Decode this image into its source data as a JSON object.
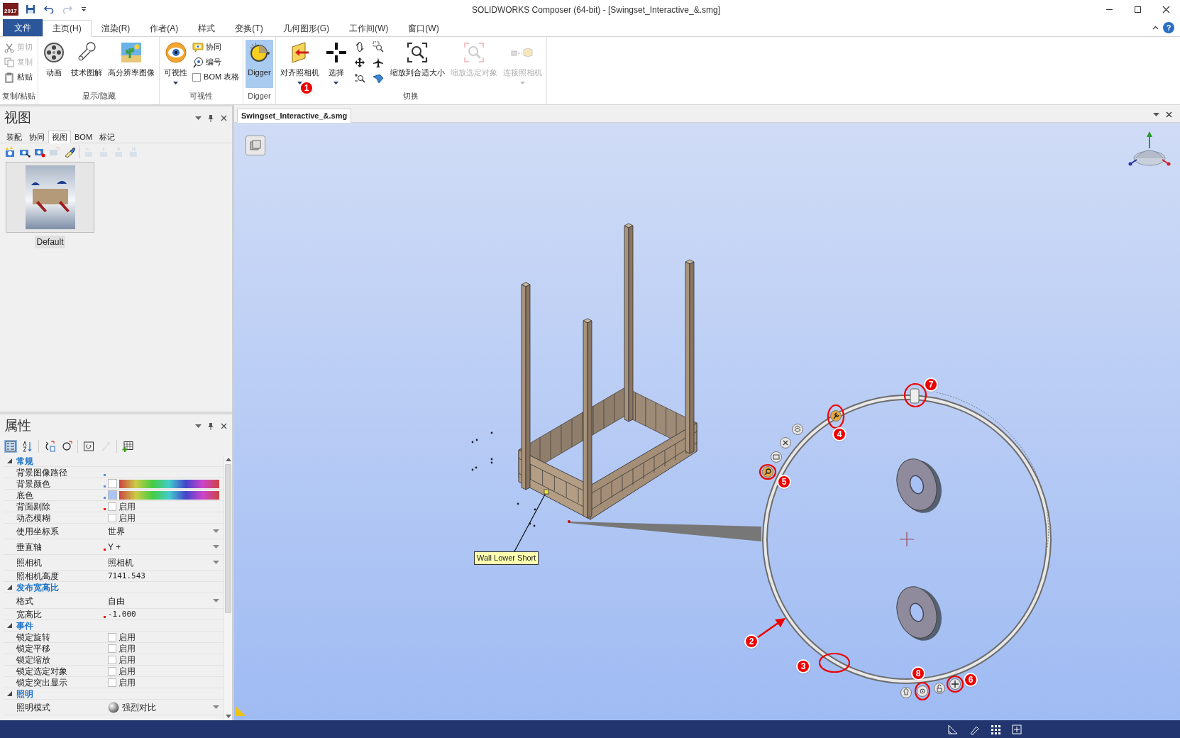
{
  "window": {
    "app_badge": "2017",
    "title": "SOLIDWORKS Composer (64-bit) - [Swingset_Interactive_&.smg]",
    "help_glyph": "?"
  },
  "ribbon_tabs": [
    {
      "label": "文件",
      "kind": "file",
      "selected": false
    },
    {
      "label": "主页(H)",
      "kind": "tab",
      "selected": true
    },
    {
      "label": "渲染(R)",
      "kind": "tab",
      "selected": false
    },
    {
      "label": "作者(A)",
      "kind": "tab",
      "selected": false
    },
    {
      "label": "样式",
      "kind": "tab",
      "selected": false
    },
    {
      "label": "变换(T)",
      "kind": "tab",
      "selected": false
    },
    {
      "label": "几何图形(G)",
      "kind": "tab",
      "selected": false
    },
    {
      "label": "工作间(W)",
      "kind": "tab",
      "selected": false
    },
    {
      "label": "窗口(W)",
      "kind": "tab",
      "selected": false
    }
  ],
  "ribbon_groups": [
    {
      "label": "复制/粘贴",
      "items": [
        {
          "kind": "small",
          "label": "剪切",
          "disabled": true
        },
        {
          "kind": "small",
          "label": "复制",
          "disabled": true
        },
        {
          "kind": "small",
          "label": "粘贴",
          "disabled": false
        }
      ]
    },
    {
      "label": "显示/隐藏",
      "items": [
        {
          "kind": "large",
          "label": "动画",
          "disabled": false
        },
        {
          "kind": "large",
          "label": "技术图解",
          "disabled": false
        },
        {
          "kind": "large",
          "label": "高分辨率图像",
          "disabled": false
        }
      ]
    },
    {
      "label": "可视性",
      "items": [
        {
          "kind": "large",
          "label": "可视性",
          "disabled": false,
          "dropdown": true
        },
        {
          "kind": "small",
          "label": "协同",
          "disabled": false
        },
        {
          "kind": "small",
          "label": "编号",
          "disabled": false
        },
        {
          "kind": "check",
          "label": "BOM 表格",
          "checked": false
        }
      ]
    },
    {
      "label": "Digger",
      "items": [
        {
          "kind": "large",
          "label": "Digger",
          "disabled": false,
          "selected": true
        }
      ]
    },
    {
      "label": "切换",
      "items": [
        {
          "kind": "large",
          "label": "对齐照相机",
          "disabled": false,
          "dropdown": true
        },
        {
          "kind": "large",
          "label": "选择",
          "disabled": false,
          "dropdown": true
        },
        {
          "kind": "icon",
          "disabled": false
        },
        {
          "kind": "icon",
          "disabled": false
        },
        {
          "kind": "icon",
          "disabled": false
        },
        {
          "kind": "icon",
          "disabled": false
        },
        {
          "kind": "icon",
          "disabled": false
        },
        {
          "kind": "icon",
          "disabled": false
        },
        {
          "kind": "large",
          "label": "缩放到合适大小",
          "disabled": false
        },
        {
          "kind": "large",
          "label": "缩放选定对象",
          "disabled": true
        },
        {
          "kind": "large",
          "label": "连接照相机",
          "disabled": true,
          "dropdown": true
        }
      ]
    }
  ],
  "ribbon_callout": "1",
  "views_panel": {
    "title": "视图",
    "tabs": [
      {
        "label": "装配",
        "selected": false
      },
      {
        "label": "协同",
        "selected": false
      },
      {
        "label": "视图",
        "selected": true
      },
      {
        "label": "BOM",
        "selected": false
      },
      {
        "label": "标记",
        "selected": false
      }
    ],
    "toolbar": [
      {
        "disabled": false
      },
      {
        "disabled": false
      },
      {
        "disabled": false
      },
      {
        "disabled": true
      },
      {
        "disabled": false
      },
      {
        "disabled": true
      },
      {
        "disabled": true
      },
      {
        "disabled": true
      },
      {
        "disabled": true
      }
    ],
    "views": [
      {
        "label": "Default",
        "selected": true
      }
    ]
  },
  "properties_panel": {
    "title": "属性",
    "toolbar": [
      {
        "selected": true,
        "disabled": false
      },
      {
        "selected": false,
        "disabled": false
      },
      {
        "selected": false,
        "disabled": false
      },
      {
        "selected": false,
        "disabled": false
      },
      {
        "selected": false,
        "disabled": false
      },
      {
        "selected": false,
        "disabled": true
      },
      {
        "selected": false,
        "disabled": false
      }
    ],
    "sections": [
      {
        "title": "常规",
        "expanded": true,
        "rows": [
          {
            "name": "背景图像路径",
            "kind": "text",
            "marker": {
              "color": "#5b8fd6"
            }
          },
          {
            "name": "背景颜色",
            "kind": "color",
            "swatch": {
              "color": "#ffffff"
            },
            "marker": {
              "color": "#5b8fd6"
            }
          },
          {
            "name": "底色",
            "kind": "color",
            "swatch": {
              "color": "#a8c4f8"
            },
            "marker": {
              "color": "#5b8fd6"
            }
          },
          {
            "name": "背面剔除",
            "kind": "check",
            "value": "启用",
            "checked": false,
            "marker": {
              "color": "#ff0000"
            }
          },
          {
            "name": "动态模糊",
            "kind": "check",
            "value": "启用",
            "checked": false
          },
          {
            "name": "使用坐标系",
            "kind": "dropdown",
            "value": "世界"
          },
          {
            "name": "垂直轴",
            "kind": "dropdown",
            "value": "Y +",
            "marker": {
              "color": "#ff0000"
            }
          },
          {
            "name": "照相机",
            "kind": "dropdown",
            "value": "照相机"
          },
          {
            "name": "照相机高度",
            "kind": "text",
            "value": "7141.543"
          }
        ]
      },
      {
        "title": "发布宽高比",
        "expanded": true,
        "rows": [
          {
            "name": "格式",
            "kind": "dropdown",
            "value": "自由"
          },
          {
            "name": "宽高比",
            "kind": "text",
            "value": "-1.000",
            "marker": {
              "color": "#ff0000"
            }
          }
        ]
      },
      {
        "title": "事件",
        "expanded": true,
        "rows": [
          {
            "name": "锁定旋转",
            "kind": "check",
            "value": "启用",
            "checked": false
          },
          {
            "name": "锁定平移",
            "kind": "check",
            "value": "启用",
            "checked": false
          },
          {
            "name": "锁定缩放",
            "kind": "check",
            "value": "启用",
            "checked": false
          },
          {
            "name": "锁定选定对象",
            "kind": "check",
            "value": "启用",
            "checked": false
          },
          {
            "name": "锁定突出显示",
            "kind": "check",
            "value": "启用",
            "checked": false
          }
        ]
      },
      {
        "title": "照明",
        "expanded": true,
        "rows": [
          {
            "name": "照明模式",
            "kind": "dropdown",
            "value": "强烈对比",
            "sphere": true
          }
        ]
      }
    ]
  },
  "viewport": {
    "document_tab": {
      "label": "Swingset_Interactive_&.smg",
      "selected": true
    },
    "part_label": "Wall Lower Short",
    "callouts": [
      "2",
      "3",
      "4",
      "5",
      "6",
      "7",
      "8"
    ]
  }
}
